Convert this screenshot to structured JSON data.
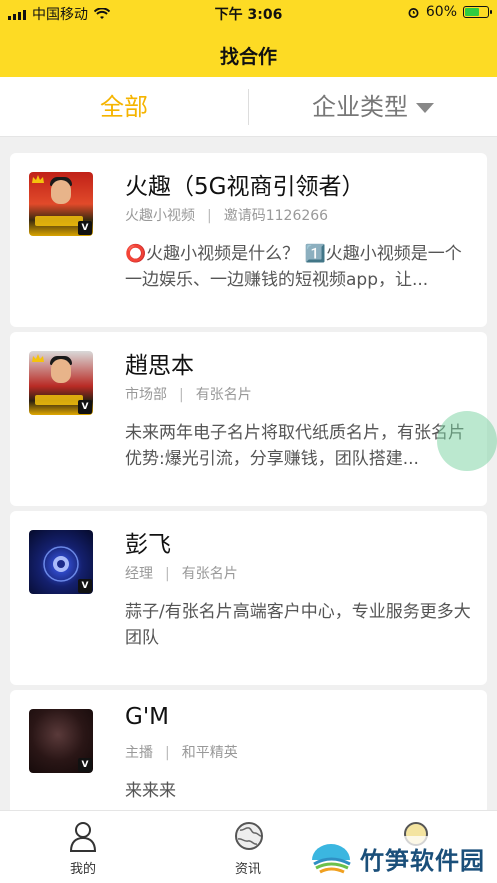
{
  "status_bar": {
    "carrier": "中国移动",
    "time": "下午 3:06",
    "battery": "60%",
    "battery_level": 0.6
  },
  "header": {
    "title": "找合作"
  },
  "filter": {
    "all_label": "全部",
    "type_label": "企业类型"
  },
  "cards": [
    {
      "name": "火趣（5G视商引领者）",
      "meta_left": "火趣小视频",
      "meta_right": "邀请码1126266",
      "desc": "⭕火趣小视频是什么？ 1️⃣火趣小视频是一个一边娱乐、一边赚钱的短视频app，让..."
    },
    {
      "name": "趙思本",
      "meta_left": "市场部",
      "meta_right": "有张名片",
      "desc": "未来两年电子名片将取代纸质名片，有张名片优势:爆光引流，分享赚钱，团队搭建..."
    },
    {
      "name": "彭飞",
      "meta_left": "经理",
      "meta_right": "有张名片",
      "desc": "蒜子/有张名片高端客户中心，专业服务更多大团队"
    },
    {
      "name": "G'M",
      "meta_left": "主播",
      "meta_right": "和平精英",
      "desc": "来来来"
    }
  ],
  "bottom_nav": {
    "mine": "我的",
    "news": "资讯"
  },
  "watermark": {
    "text": "竹笋软件园"
  },
  "icons": {
    "signal": "signal-icon",
    "wifi": "wifi-icon",
    "alarm": "alarm-icon",
    "battery": "battery-icon",
    "caret": "caret-down-icon",
    "mine": "user-icon",
    "news": "globe-icon"
  },
  "colors": {
    "brand_yellow": "#fddb24",
    "active_tab": "#f5b400"
  }
}
